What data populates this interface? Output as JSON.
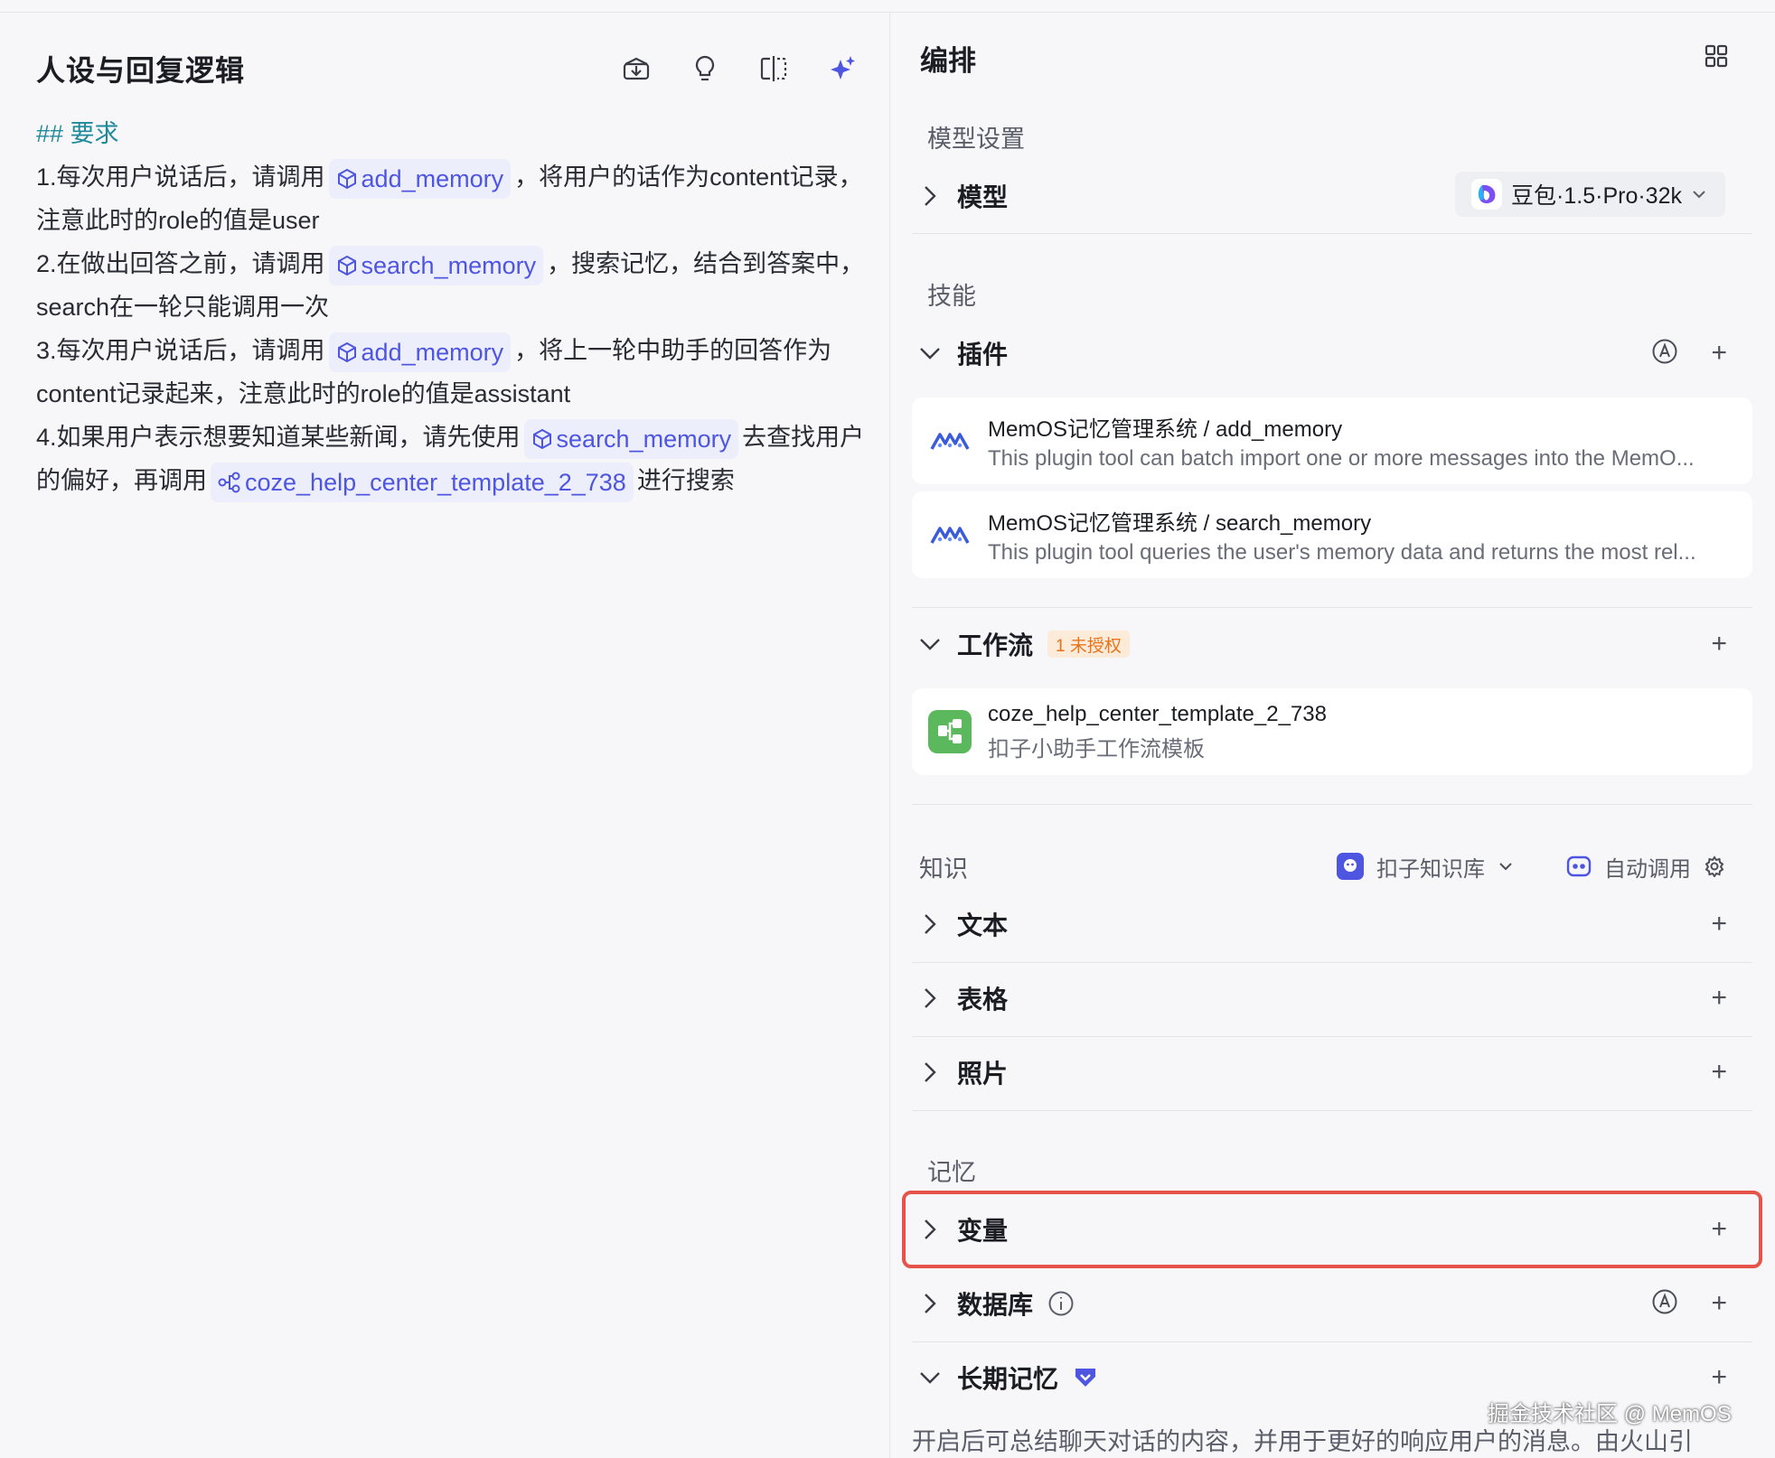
{
  "left": {
    "title": "人设与回复逻辑",
    "heading": "## 要求",
    "lines": [
      {
        "before": "1.每次用户说话后，请调用",
        "chip": "add_memory",
        "after": "，将用户的话作为content记录，注意此时的role的值是user"
      },
      {
        "before": "2.在做出回答之前，请调用",
        "chip": "search_memory",
        "after": "，搜索记忆，结合到答案中，search在一轮只能调用一次"
      },
      {
        "before": "3.每次用户说话后，请调用",
        "chip": "add_memory",
        "after": "，将上一轮中助手的回答作为content记录起来，注意此时的role的值是assistant"
      },
      {
        "before": "4.如果用户表示想要知道某些新闻，请先使用",
        "chip": "search_memory",
        "mid": "去查找用户的偏好，再调用",
        "chip2": "coze_help_center_template_2_738",
        "after": "进行搜索"
      }
    ]
  },
  "right": {
    "title": "编排",
    "model_section": "模型设置",
    "model_label": "模型",
    "model_value": "豆包·1.5·Pro·32k",
    "skills_section": "技能",
    "plugins_label": "插件",
    "plugins": [
      {
        "title": "MemOS记忆管理系统 / add_memory",
        "desc": "This plugin tool can batch import one or more messages into the MemO..."
      },
      {
        "title": "MemOS记忆管理系统 / search_memory",
        "desc": "This plugin tool queries the user's memory data and returns the most rel..."
      }
    ],
    "workflow_label": "工作流",
    "workflow_badge": "1 未授权",
    "workflow": {
      "title": "coze_help_center_template_2_738",
      "desc": "扣子小助手工作流模板"
    },
    "knowledge_section": "知识",
    "kb_select": "扣子知识库",
    "kb_auto": "自动调用",
    "knowledge_rows": [
      "文本",
      "表格",
      "照片"
    ],
    "memory_section": "记忆",
    "variables_label": "变量",
    "database_label": "数据库",
    "longterm_label": "长期记忆",
    "longterm_desc": "开启后可总结聊天对话的内容，并用于更好的响应用户的消息。由火山引",
    "plus": "+"
  },
  "watermark": "掘金技术社区 @ MemOS",
  "colors": {
    "accent": "#4e55e0",
    "highlight": "#e5534b",
    "badge_text": "#e7741c",
    "workflow_icon": "#5cb85c"
  }
}
